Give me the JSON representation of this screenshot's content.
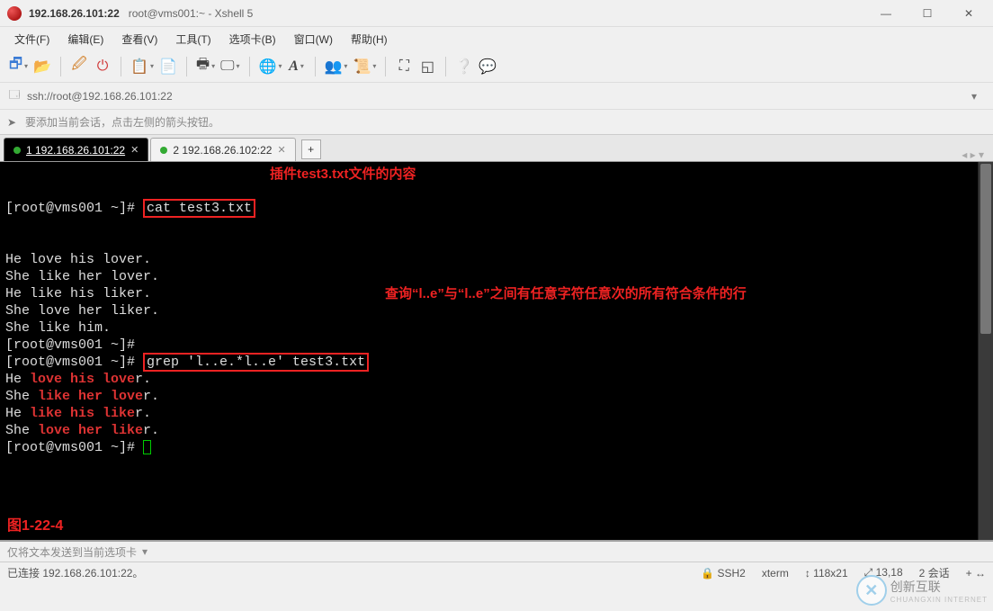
{
  "window": {
    "title_main": "192.168.26.101:22",
    "title_sub": "root@vms001:~ - Xshell 5"
  },
  "menu": {
    "items": [
      {
        "label": "文件(F)"
      },
      {
        "label": "编辑(E)"
      },
      {
        "label": "查看(V)"
      },
      {
        "label": "工具(T)"
      },
      {
        "label": "选项卡(B)"
      },
      {
        "label": "窗口(W)"
      },
      {
        "label": "帮助(H)"
      }
    ]
  },
  "toolbar": {
    "icons": [
      {
        "name": "new-session-icon",
        "glyph": "🗗",
        "drop": true,
        "color": "#3a7bd5"
      },
      {
        "name": "open-icon",
        "glyph": "📂"
      },
      {
        "sep": true
      },
      {
        "name": "reconnect-icon",
        "glyph": "🖉",
        "color": "#d17b1f"
      },
      {
        "name": "disconnect-icon",
        "glyph": "⏻",
        "color": "#d13a3a"
      },
      {
        "sep": true
      },
      {
        "name": "copy-icon",
        "glyph": "📋",
        "drop": true
      },
      {
        "name": "paste-icon",
        "glyph": "📄"
      },
      {
        "sep": true
      },
      {
        "name": "find-icon",
        "glyph": "🖶",
        "drop": true
      },
      {
        "name": "screen-icon",
        "glyph": "🖵",
        "drop": true
      },
      {
        "sep": true
      },
      {
        "name": "color-icon",
        "glyph": "🌐",
        "drop": true
      },
      {
        "name": "font-icon",
        "glyph": "A",
        "drop": true,
        "style": "italic bold"
      },
      {
        "sep": true
      },
      {
        "name": "users-icon",
        "glyph": "👥",
        "drop": true
      },
      {
        "name": "script-icon",
        "glyph": "📜",
        "drop": true
      },
      {
        "sep": true
      },
      {
        "name": "fullscreen-icon",
        "glyph": "⛶"
      },
      {
        "name": "transparent-icon",
        "glyph": "◱"
      },
      {
        "sep": true
      },
      {
        "name": "help-icon",
        "glyph": "❔"
      },
      {
        "name": "chat-icon",
        "glyph": "💬"
      }
    ]
  },
  "address": {
    "value": "ssh://root@192.168.26.101:22"
  },
  "hint": {
    "text": "要添加当前会话，点击左侧的箭头按钮。"
  },
  "tabs": {
    "items": [
      {
        "label": "1 192.168.26.101:22",
        "active": true
      },
      {
        "label": "2 192.168.26.102:22",
        "active": false
      }
    ],
    "add_label": "+"
  },
  "terminal": {
    "prompt": "[root@vms001 ~]#",
    "cmd1": "cat test3.txt",
    "anno1": "插件test3.txt文件的内容",
    "cat_output": [
      "He love his lover.",
      "She like her lover.",
      "He like his liker.",
      "She love her liker.",
      "She like him."
    ],
    "cmd2": "grep 'l..e.*l..e' test3.txt",
    "anno2": "查询“l..e”与“l..e”之间有任意字符任意次的所有符合条件的行",
    "grep_output": [
      {
        "pre": "He ",
        "m1": "love his love",
        "post": "r."
      },
      {
        "pre": "She ",
        "m1": "like her love",
        "post": "r."
      },
      {
        "pre": "He ",
        "m1": "like his like",
        "post": "r."
      },
      {
        "pre": "She ",
        "m1": "love her like",
        "post": "r."
      }
    ],
    "fig_label": "图1-22-4"
  },
  "sendbar": {
    "label": "仅将文本发送到当前选项卡"
  },
  "status": {
    "left": "已连接 192.168.26.101:22。",
    "right": {
      "proto": "SSH2",
      "term": "xterm",
      "size": "118x21",
      "pos": "13,18",
      "sessions": "2 会话"
    },
    "lock_glyph": "🔒",
    "arrows_glyph": "↕",
    "size_icon": "⤢",
    "plus_glyph": "+  ↔"
  },
  "watermark": {
    "brand": "创新互联",
    "sub": "CHUANGXIN INTERNET"
  }
}
